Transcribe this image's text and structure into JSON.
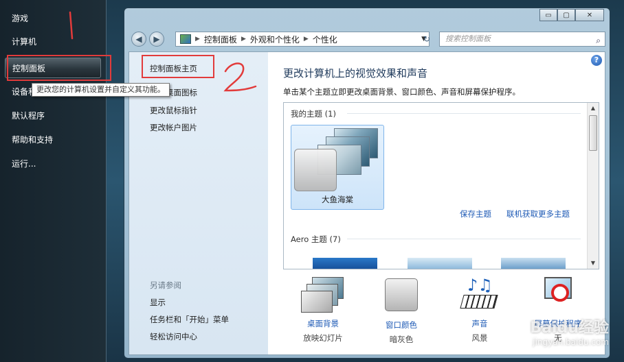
{
  "start_menu": {
    "items": [
      {
        "label": "游戏"
      },
      {
        "label": "计算机"
      },
      {
        "label": "控制面板"
      },
      {
        "label": "设备和打印机"
      },
      {
        "label": "默认程序"
      },
      {
        "label": "帮助和支持"
      },
      {
        "label": "运行..."
      }
    ],
    "tooltip": "更改您的计算机设置并自定义其功能。"
  },
  "window": {
    "caption": {
      "minimize": "▭",
      "maximize": "▢",
      "close": "✕"
    },
    "breadcrumb": [
      "控制面板",
      "外观和个性化",
      "个性化"
    ],
    "search_placeholder": "搜索控制面板",
    "help": "?",
    "left_pane": {
      "links": [
        "控制面板主页",
        "更改桌面图标",
        "更改鼠标指针",
        "更改帐户图片"
      ],
      "see_also_title": "另请参阅",
      "see_also": [
        "显示",
        "任务栏和「开始」菜单",
        "轻松访问中心"
      ]
    },
    "main": {
      "title": "更改计算机上的视觉效果和声音",
      "subtitle": "单击某个主题立即更改桌面背景、窗口颜色、声音和屏幕保护程序。",
      "my_themes_header": "我的主题 (1)",
      "selected_theme": "大鱼海棠",
      "save_theme": "保存主题",
      "get_more_themes": "联机获取更多主题",
      "aero_header": "Aero 主题 (7)",
      "bottom": [
        {
          "label": "桌面背景",
          "value": "放映幻灯片",
          "icon": "desktop-background-icon"
        },
        {
          "label": "窗口颜色",
          "value": "暗灰色",
          "icon": "window-color-icon"
        },
        {
          "label": "声音",
          "value": "风景",
          "icon": "sound-icon"
        },
        {
          "label": "屏幕保护程序",
          "value": "无",
          "icon": "screensaver-icon"
        }
      ]
    }
  },
  "annotations": {
    "mark1": "1",
    "mark2": "2"
  },
  "watermark": {
    "brand": "Baidu经验",
    "url": "jingyan.baidu.com"
  },
  "colors": {
    "accent": "#1e5ab5",
    "annotation": "#e23b3b",
    "title": "#1e395b"
  }
}
